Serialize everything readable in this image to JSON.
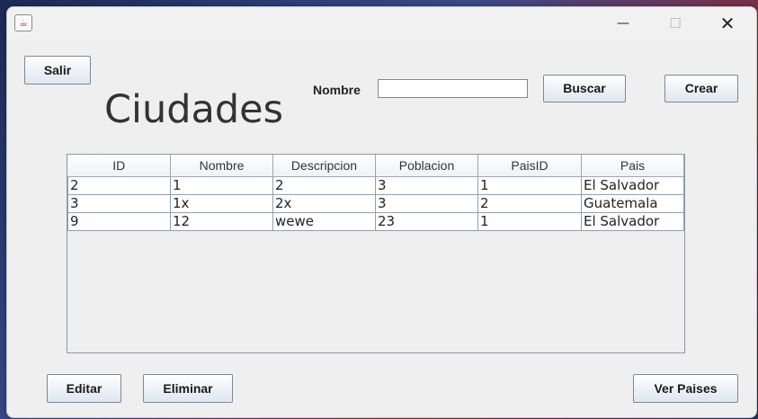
{
  "window": {
    "app_icon": "java-app-icon",
    "controls": {
      "minimize": "minimize-icon",
      "maximize": "maximize-icon",
      "close": "close-icon"
    }
  },
  "buttons": {
    "salir": "Salir",
    "buscar": "Buscar",
    "crear": "Crear",
    "editar": "Editar",
    "eliminar": "Eliminar",
    "ver_paises": "Ver Paises"
  },
  "heading": "Ciudades",
  "search": {
    "label": "Nombre",
    "value": ""
  },
  "table": {
    "columns": [
      "ID",
      "Nombre",
      "Descripcion",
      "Poblacion",
      "PaisID",
      "Pais"
    ],
    "rows": [
      [
        "2",
        "1",
        "2",
        "3",
        "1",
        "El Salvador"
      ],
      [
        "3",
        "1x",
        "2x",
        "3",
        "2",
        "Guatemala"
      ],
      [
        "9",
        "12",
        "wewe",
        "23",
        "1",
        "El Salvador"
      ]
    ]
  },
  "colors": {
    "window_bg": "#efefef",
    "button_gradient_end": "#dde6f0",
    "border": "#7a8a99"
  }
}
